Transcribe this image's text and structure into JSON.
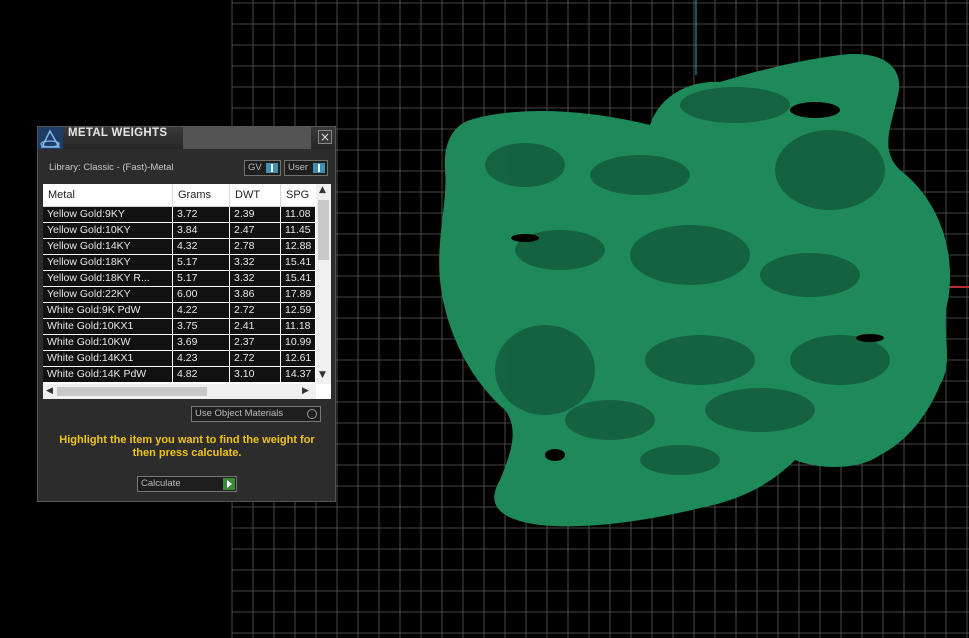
{
  "dialog": {
    "title": "METAL WEIGHTS",
    "close_icon": "close-icon",
    "library_label": "Library: Classic - (Fast)-Metal",
    "toggle_gv": "GV",
    "toggle_user": "User",
    "use_object_materials": "Use Object Materials",
    "instructions": "Highlight the item you want to find the weight for then press calculate.",
    "calculate": "Calculate"
  },
  "table": {
    "columns": [
      "Metal",
      "Grams",
      "DWT",
      "SPG"
    ],
    "rows": [
      [
        "Yellow Gold:9KY",
        "3.72",
        "2.39",
        "11.08"
      ],
      [
        "Yellow Gold:10KY",
        "3.84",
        "2.47",
        "11.45"
      ],
      [
        "Yellow Gold:14KY",
        "4.32",
        "2.78",
        "12.88"
      ],
      [
        "Yellow Gold:18KY",
        "5.17",
        "3.32",
        "15.41"
      ],
      [
        "Yellow Gold:18KY R...",
        "5.17",
        "3.32",
        "15.41"
      ],
      [
        "Yellow Gold:22KY",
        "6.00",
        "3.86",
        "17.89"
      ],
      [
        "White Gold:9K PdW",
        "4.22",
        "2.72",
        "12.59"
      ],
      [
        "White Gold:10KX1",
        "3.75",
        "2.41",
        "11.18"
      ],
      [
        "White Gold:10KW",
        "3.69",
        "2.37",
        "10.99"
      ],
      [
        "White Gold:14KX1",
        "4.23",
        "2.72",
        "12.61"
      ],
      [
        "White Gold:14K PdW",
        "4.82",
        "3.10",
        "14.37"
      ]
    ]
  },
  "colors": {
    "model_green": "#1e8a5a",
    "grid_line": "#5a5a5a",
    "instruction_text": "#f0c419"
  }
}
